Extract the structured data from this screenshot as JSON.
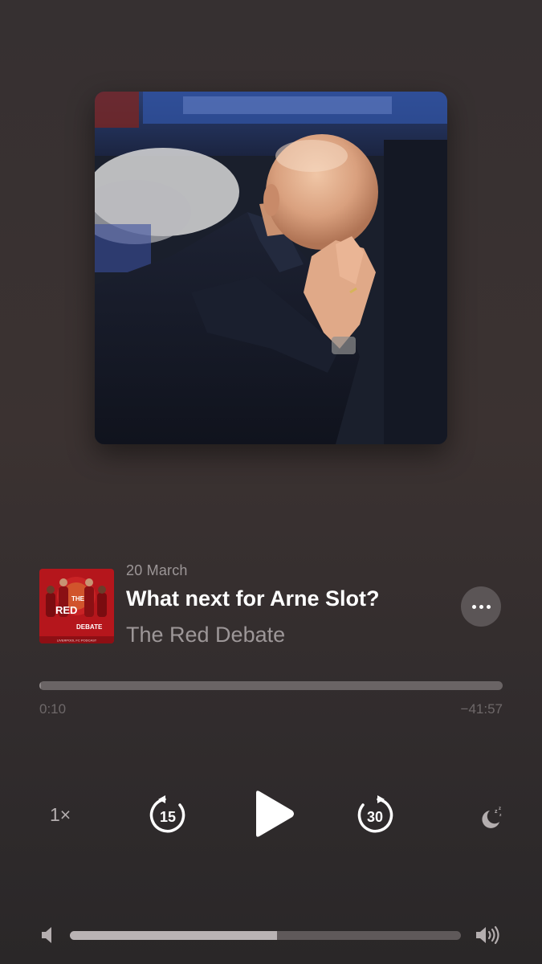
{
  "episode": {
    "date": "20 March",
    "title": "What next for Arne Slot?",
    "show": "The Red Debate"
  },
  "thumbnail": {
    "line1": "THE",
    "line2": "RED",
    "line3": "DEBATE",
    "footer": "LIVERPOOL FC PODCAST"
  },
  "progress": {
    "elapsed": "0:10",
    "remaining": "−41:57",
    "fraction": 0.004
  },
  "controls": {
    "speed_label": "1×",
    "skip_back_seconds": "15",
    "skip_forward_seconds": "30",
    "play_icon": "play-icon",
    "sleep_icon": "sleep-timer-icon",
    "more_icon": "ellipsis-icon"
  },
  "volume": {
    "level": 0.53
  },
  "colors": {
    "thumbnail_red": "#b5161c",
    "progress_track": "#6a6465",
    "volume_fill": "#b9b3b4"
  }
}
